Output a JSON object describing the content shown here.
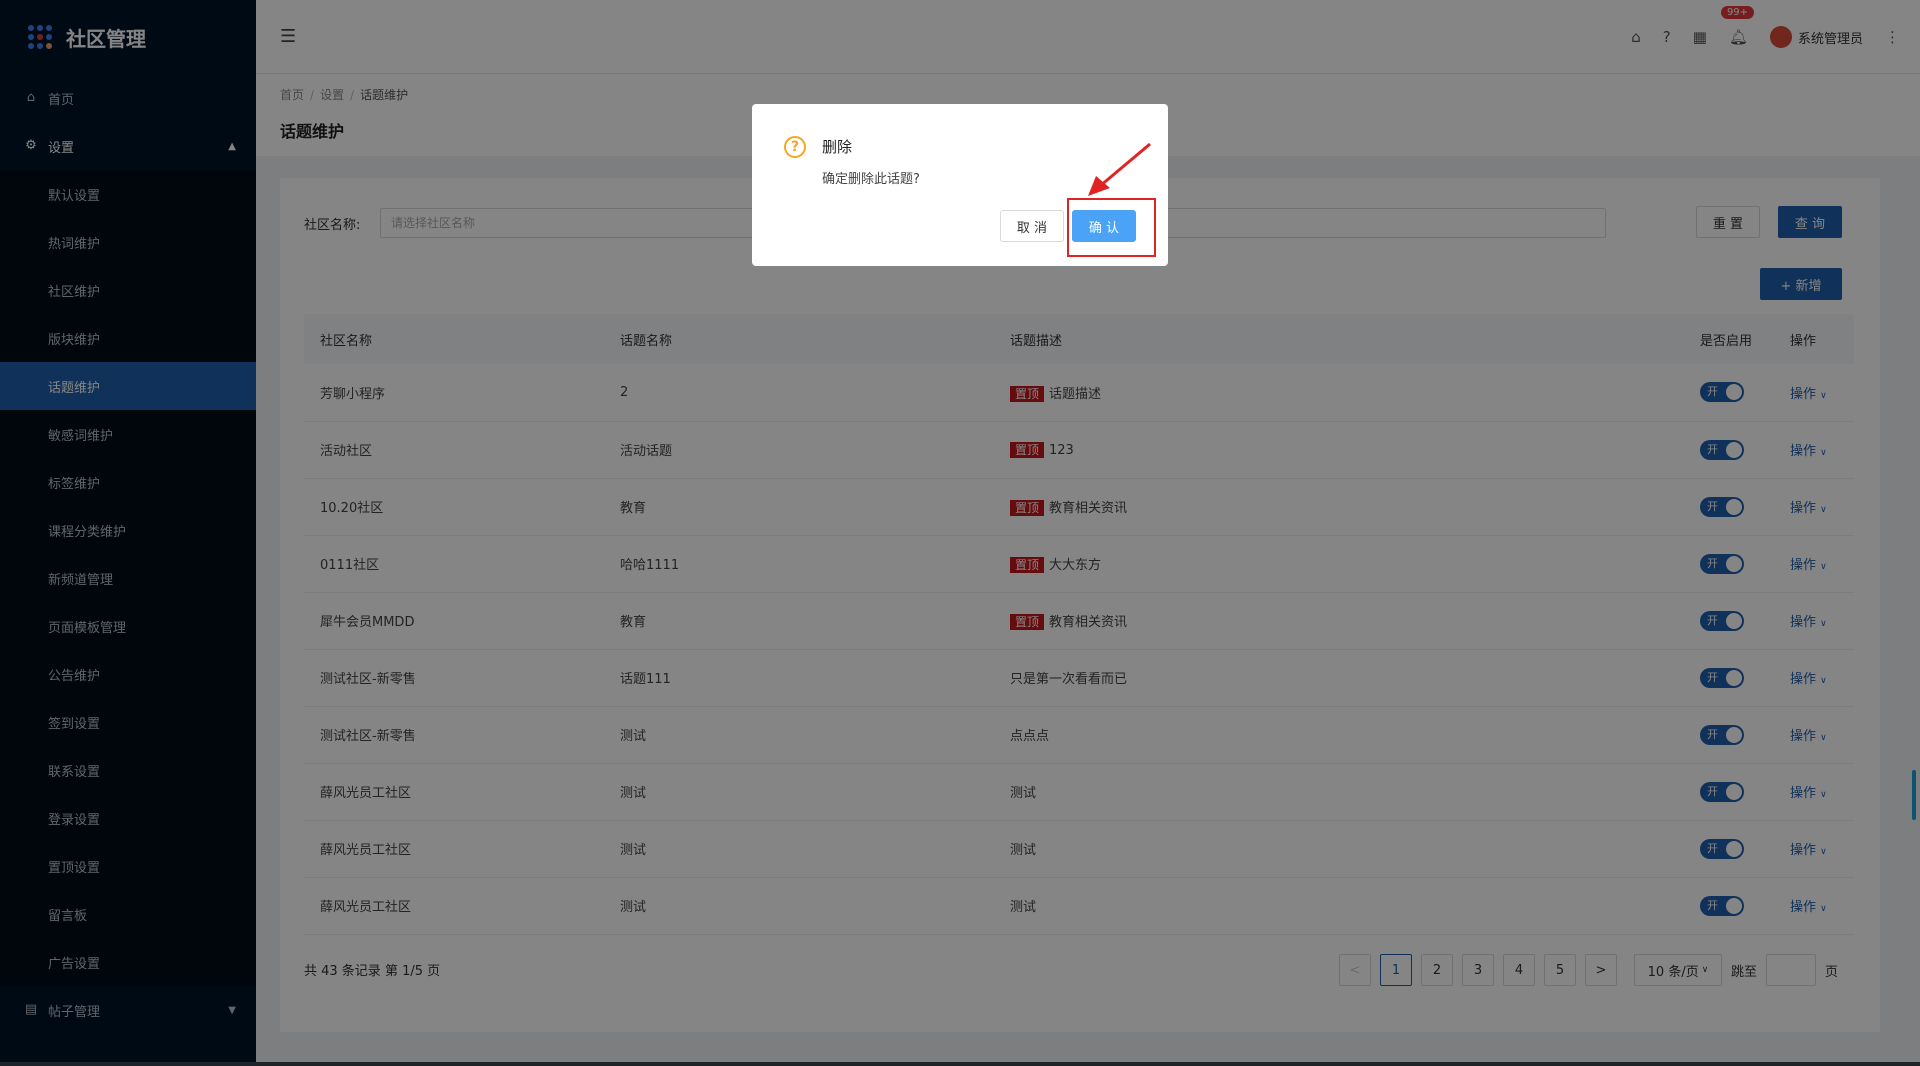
{
  "app": {
    "title": "社区管理"
  },
  "sidebar": {
    "home": "首页",
    "settings": "设置",
    "items": [
      "默认设置",
      "热词维护",
      "社区维护",
      "版块维护",
      "话题维护",
      "敏感词维护",
      "标签维护",
      "课程分类维护",
      "新频道管理",
      "页面模板管理",
      "公告维护",
      "签到设置",
      "联系设置",
      "登录设置",
      "置顶设置",
      "留言板",
      "广告设置"
    ],
    "active_index": 4,
    "posts": "帖子管理"
  },
  "header": {
    "badge": "99+",
    "user": "系统管理员"
  },
  "breadcrumb": [
    "首页",
    "设置",
    "话题维护"
  ],
  "page_title": "话题维护",
  "filter": {
    "label": "社区名称:",
    "placeholder": "请选择社区名称"
  },
  "buttons": {
    "reset": "重 置",
    "query": "查 询",
    "add": "+ 新增"
  },
  "table": {
    "headers": [
      "社区名称",
      "话题名称",
      "话题描述",
      "是否启用",
      "操作"
    ],
    "rows": [
      {
        "community": "芳聊小程序",
        "topic": "2",
        "tag": "置顶",
        "desc": "话题描述"
      },
      {
        "community": "活动社区",
        "topic": "活动话题",
        "tag": "置顶",
        "desc": "123"
      },
      {
        "community": "10.20社区",
        "topic": "教育",
        "tag": "置顶",
        "desc": "教育相关资讯"
      },
      {
        "community": "0111社区",
        "topic": "哈哈1111",
        "tag": "置顶",
        "desc": "大大东方"
      },
      {
        "community": "犀牛会员MMDD",
        "topic": "教育",
        "tag": "置顶",
        "desc": "教育相关资讯"
      },
      {
        "community": "测试社区-新零售",
        "topic": "话题111",
        "tag": "",
        "desc": "只是第一次看看而已"
      },
      {
        "community": "测试社区-新零售",
        "topic": "测试",
        "tag": "",
        "desc": "点点点"
      },
      {
        "community": "薛风光员工社区",
        "topic": "测试",
        "tag": "",
        "desc": "测试"
      },
      {
        "community": "薛风光员工社区",
        "topic": "测试",
        "tag": "",
        "desc": "测试"
      },
      {
        "community": "薛风光员工社区",
        "topic": "测试",
        "tag": "",
        "desc": "测试"
      }
    ],
    "switch_label": "开",
    "op_label": "操作"
  },
  "pagination": {
    "total_text": "共 43 条记录 第 1/5 页",
    "pages": [
      "1",
      "2",
      "3",
      "4",
      "5"
    ],
    "prev": "<",
    "next": ">",
    "size": "10 条/页",
    "jump": "跳至",
    "page_unit": "页"
  },
  "modal": {
    "title": "删除",
    "content": "确定删除此话题?",
    "cancel": "取 消",
    "ok": "确 认"
  },
  "colors": {
    "primary": "#1f5fad",
    "sidebar": "#001529",
    "tag": "#c4161c",
    "warn": "#f5a623",
    "annotation": "#e02323"
  }
}
